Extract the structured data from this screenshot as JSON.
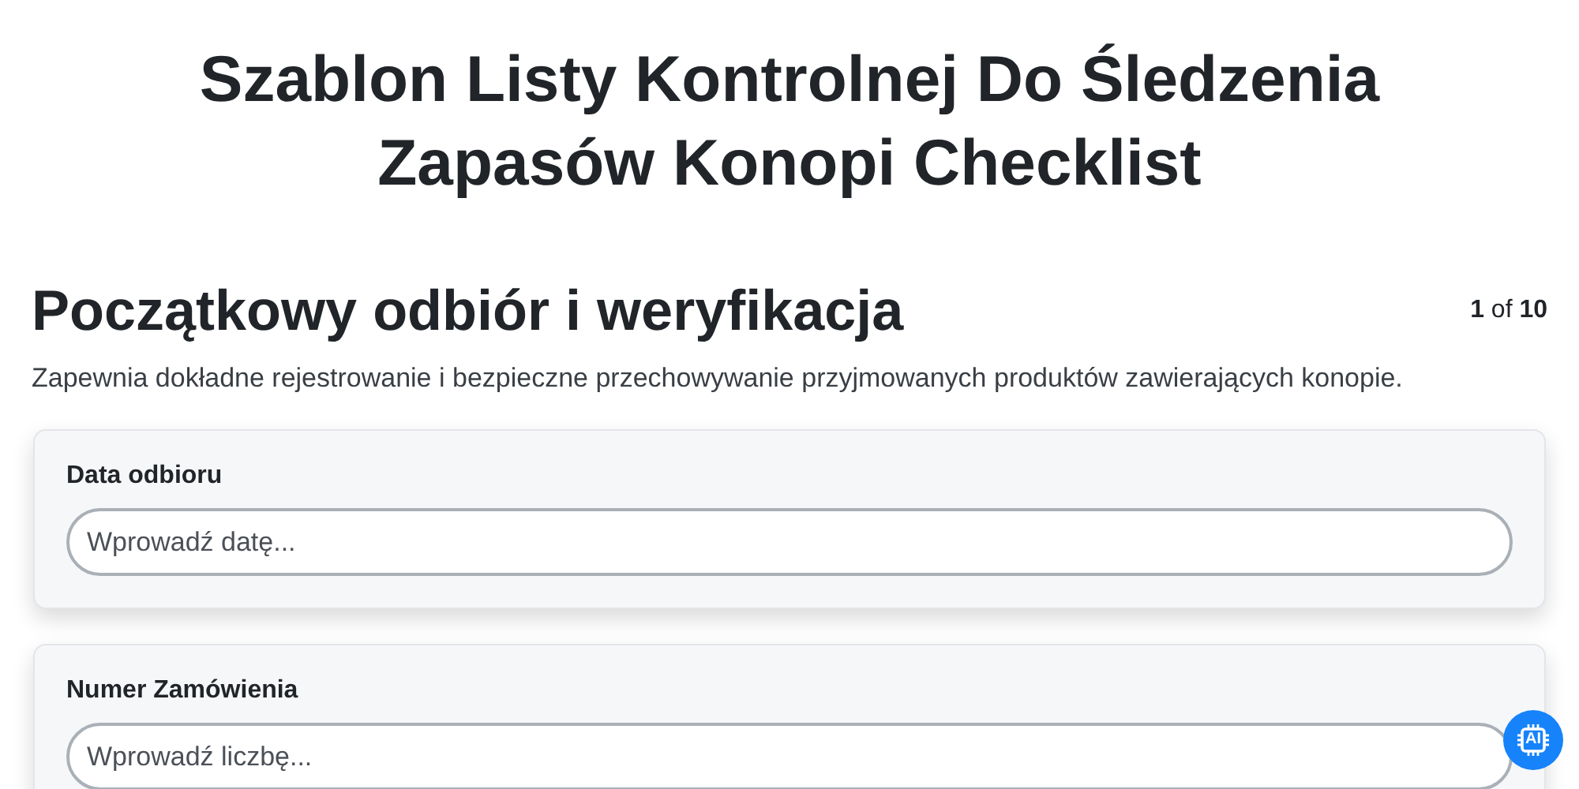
{
  "title": "Szablon Listy Kontrolnej Do Śledzenia Zapasów Konopi Checklist",
  "section": {
    "heading": "Początkowy odbiór i weryfikacja",
    "counter": "**1** of **10**",
    "description": "Zapewnia dokładne rejestrowanie i bezpieczne przechowywanie przyjmowanych produktów zawierających konopie."
  },
  "fields": [
    {
      "label": "Data odbioru",
      "placeholder": "Wprowadź datę..."
    },
    {
      "label": "Numer Zamówienia",
      "placeholder": "Wprowadź liczbę..."
    }
  ],
  "ai_badge": "AI"
}
